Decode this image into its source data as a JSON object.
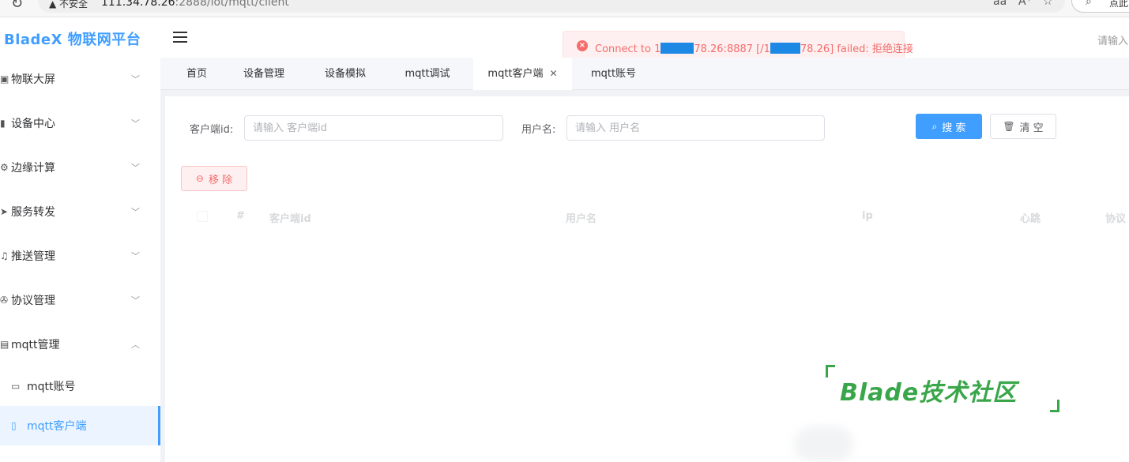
{
  "browser": {
    "security_label": "不安全",
    "url_host": "111.34.78.26",
    "url_rest": ":2888/iot/mqtt/client",
    "right_text": "点此"
  },
  "sidebar": {
    "logo": "BladeX 物联网平台",
    "menu": [
      {
        "icon": "screen-icon",
        "label": "物联大屏",
        "expanded": false
      },
      {
        "icon": "device-icon",
        "label": "设备中心",
        "expanded": false
      },
      {
        "icon": "edge-icon",
        "label": "边缘计算",
        "expanded": false
      },
      {
        "icon": "forward-icon",
        "label": "服务转发",
        "expanded": false
      },
      {
        "icon": "bell-icon",
        "label": "推送管理",
        "expanded": false
      },
      {
        "icon": "protocol-icon",
        "label": "协议管理",
        "expanded": false
      },
      {
        "icon": "mqtt-icon",
        "label": "mqtt管理",
        "expanded": true
      }
    ],
    "submenu": [
      {
        "icon": "id-card-icon",
        "label": "mqtt账号",
        "active": false
      },
      {
        "icon": "phone-icon",
        "label": "mqtt客户端",
        "active": true
      }
    ]
  },
  "header": {
    "search_text": "请输入",
    "toast": {
      "prefix": "Connect to 1",
      "mid1": "78.26:8887 [/1",
      "mid2": "78.26] failed: 拒绝连接"
    }
  },
  "tabs": [
    {
      "label": "首页",
      "active": false
    },
    {
      "label": "设备管理",
      "active": false
    },
    {
      "label": "设备模拟",
      "active": false
    },
    {
      "label": "mqtt调试",
      "active": false
    },
    {
      "label": "mqtt客户端",
      "active": true,
      "closable": true
    },
    {
      "label": "mqtt账号",
      "active": false
    }
  ],
  "filters": {
    "client_id_label": "客户端id:",
    "client_id_placeholder": "请输入 客户端id",
    "client_id_value": "",
    "username_label": "用户名:",
    "username_placeholder": "请输入 用户名",
    "username_value": ""
  },
  "buttons": {
    "search": "搜 索",
    "clear": "清 空",
    "remove": "移 除"
  },
  "table": {
    "columns": [
      "#",
      "客户端id",
      "用户名",
      "ip",
      "心跳",
      "协议"
    ]
  },
  "watermark": "Blade技术社区",
  "colors": {
    "primary": "#409eff",
    "danger": "#f56c6c",
    "watermark": "#3aa64a"
  }
}
